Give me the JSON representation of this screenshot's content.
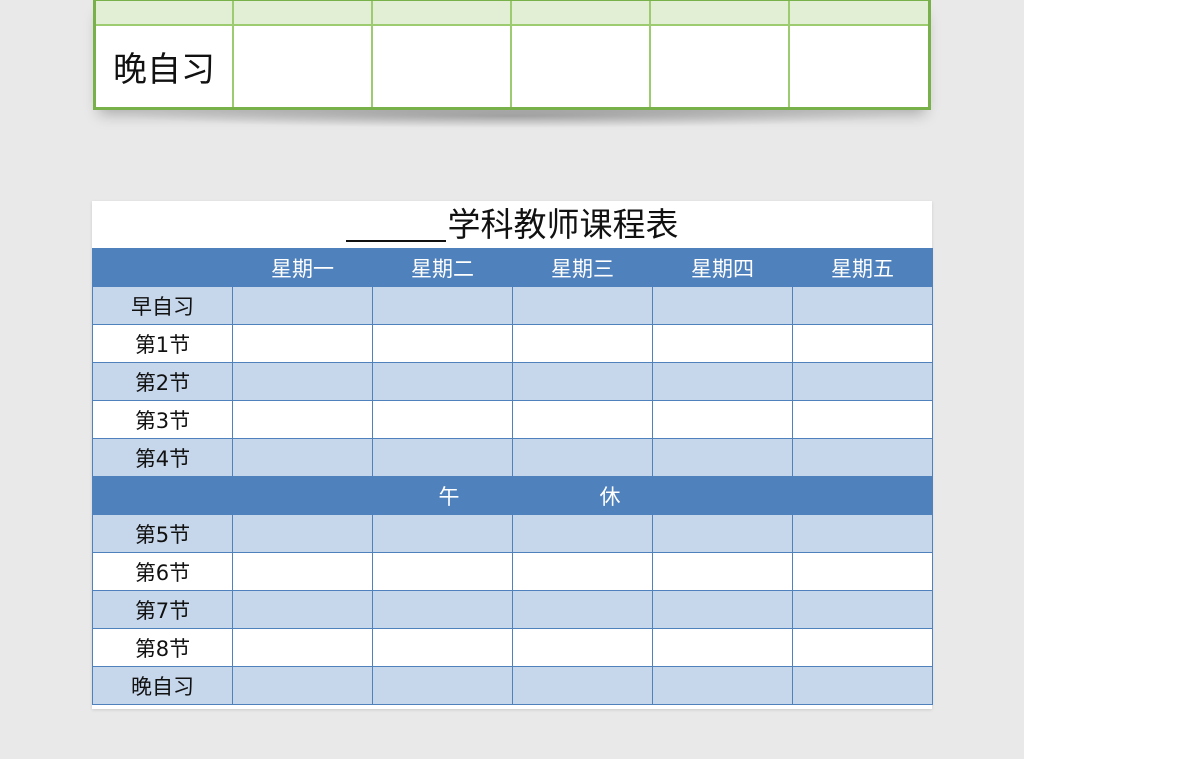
{
  "top_table": {
    "row_label": "晚自习"
  },
  "schedule": {
    "title": "学科教师课程表",
    "days": [
      "星期一",
      "星期二",
      "星期三",
      "星期四",
      "星期五"
    ],
    "morning_rows": [
      "早自习",
      "第1节",
      "第2节",
      "第3节",
      "第4节"
    ],
    "break": [
      "午",
      "休"
    ],
    "afternoon_rows": [
      "第5节",
      "第6节",
      "第7节",
      "第8节",
      "晚自习"
    ]
  },
  "colors": {
    "header_blue": "#4f81bd",
    "band_blue": "#c6d6eb",
    "green_border": "#78b04a"
  }
}
